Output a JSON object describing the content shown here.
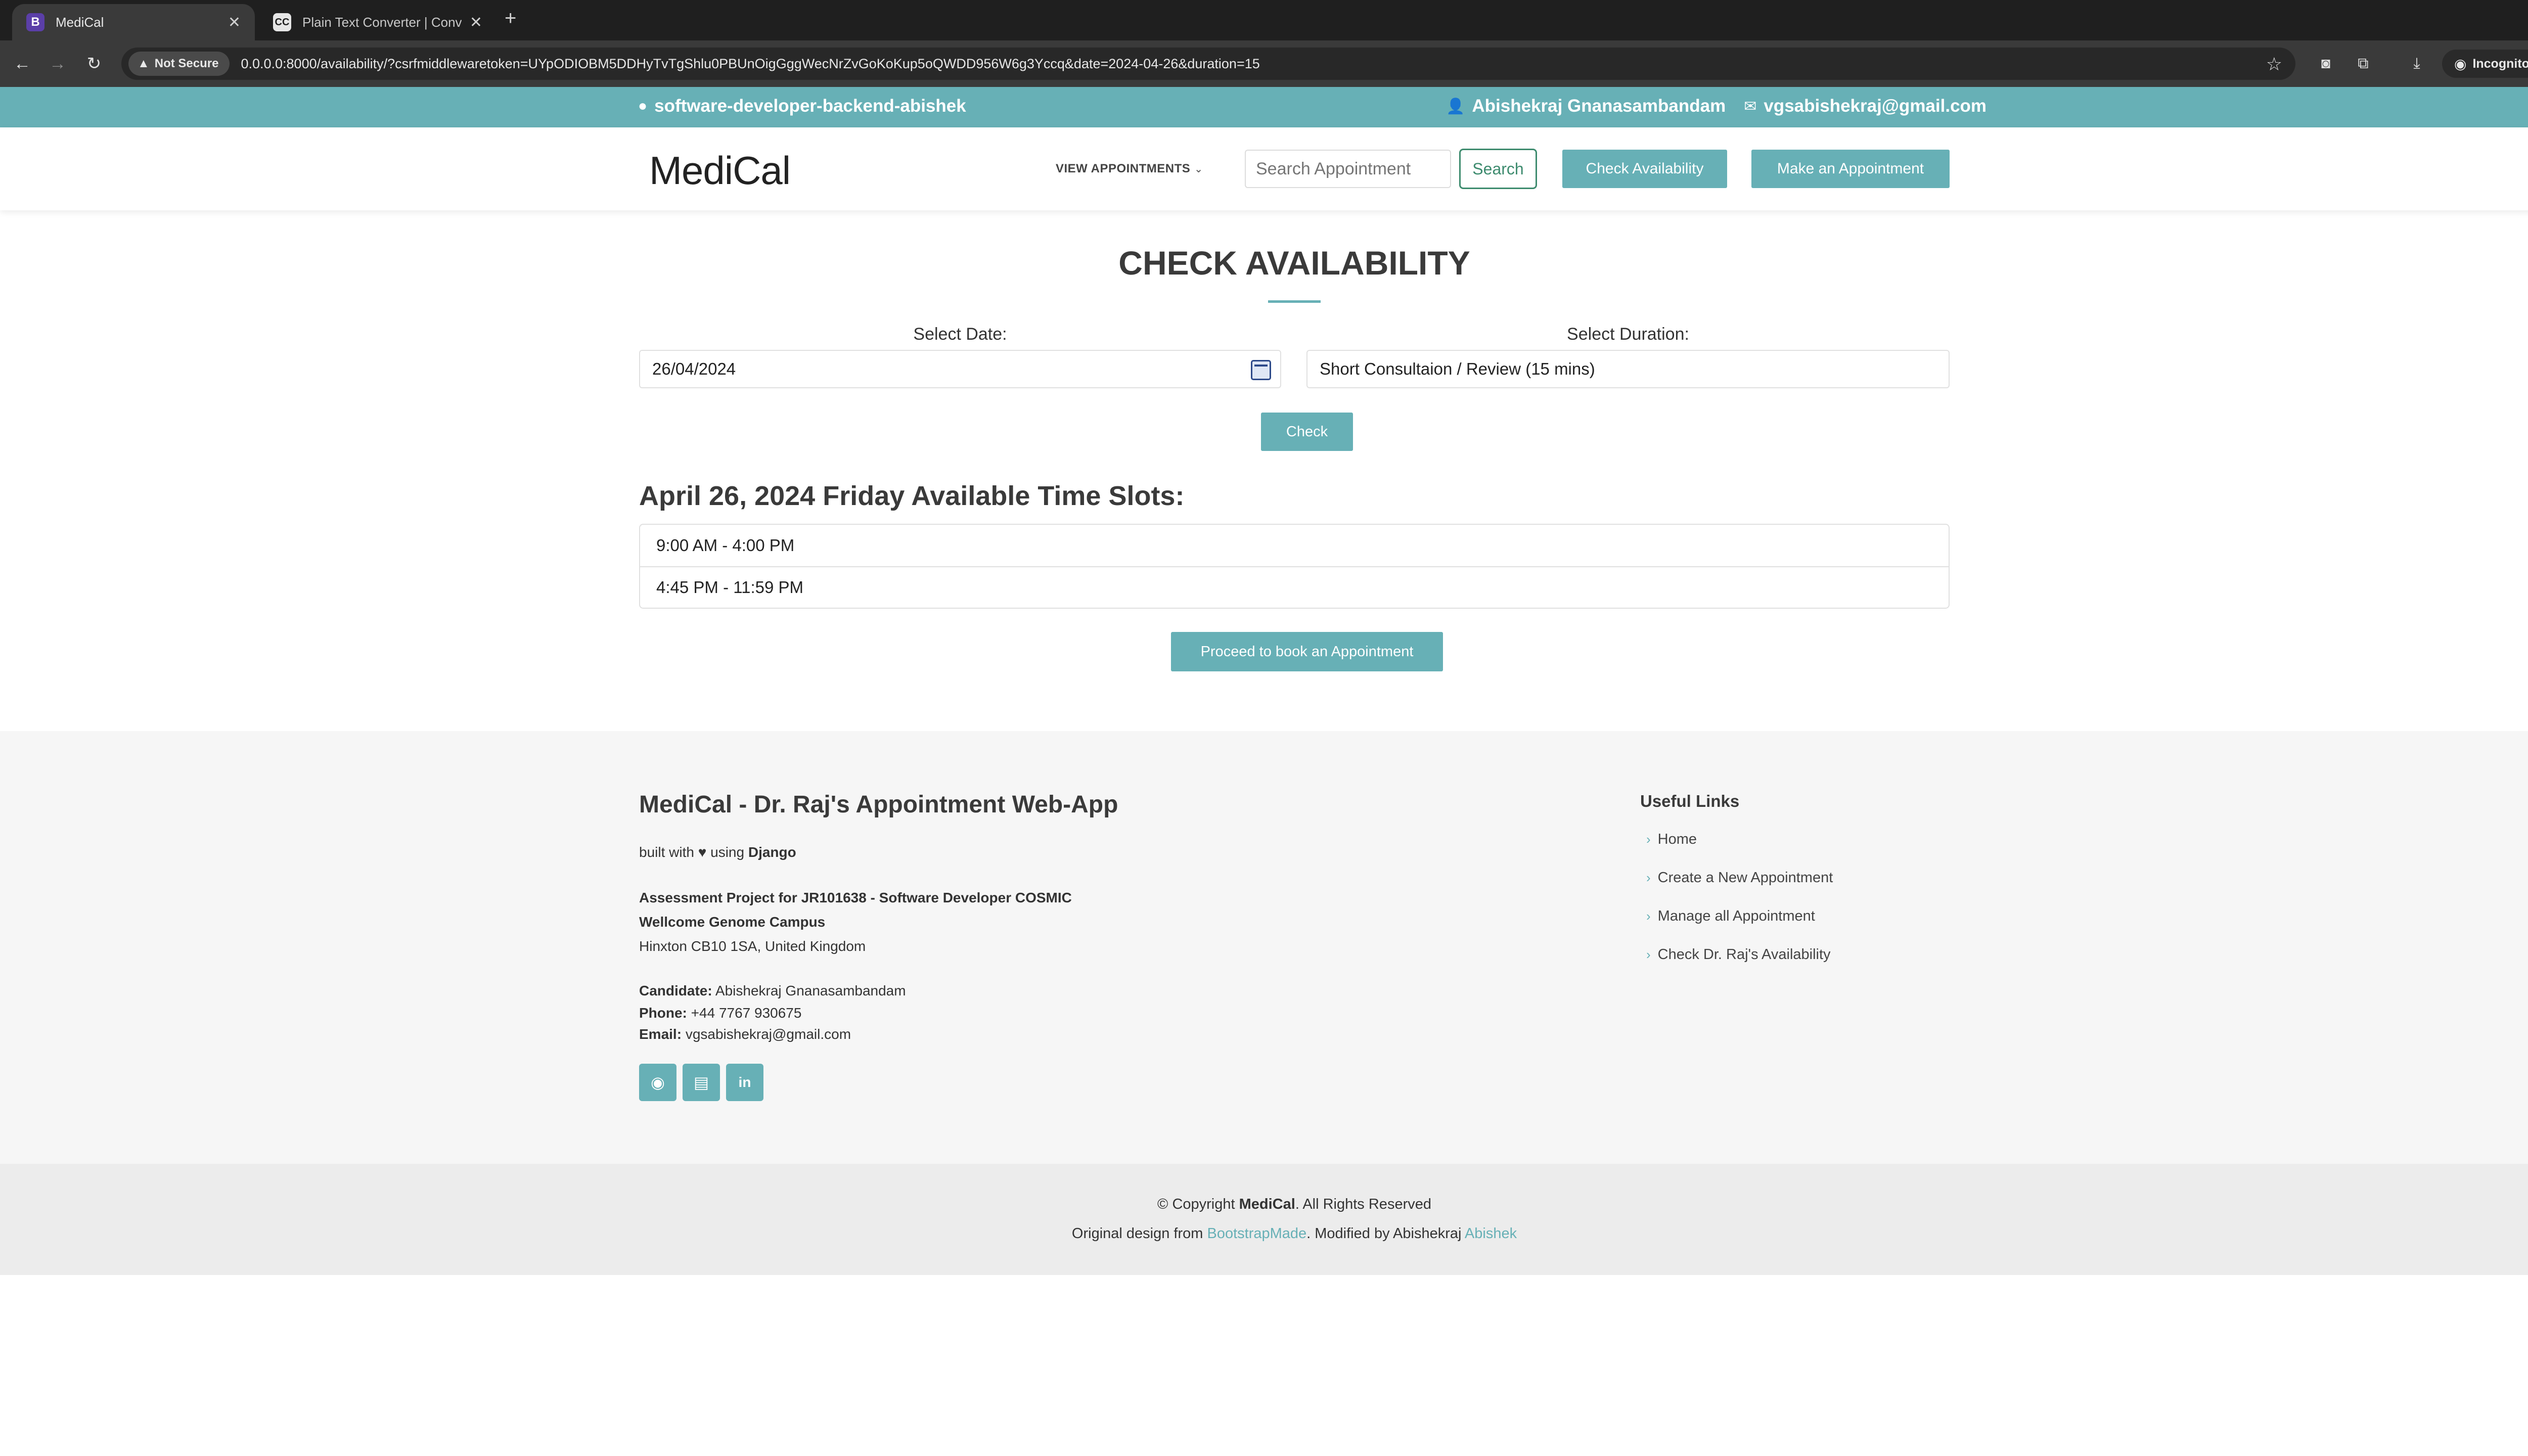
{
  "browser": {
    "tabs": [
      {
        "favicon": "B",
        "title": "MediCal",
        "active": true
      },
      {
        "favicon": "CC",
        "title": "Plain Text Converter | Conve",
        "active": false
      }
    ],
    "not_secure": "Not Secure",
    "url": "0.0.0.0:8000/availability/?csrfmiddlewaretoken=UYpODIOBM5DDHyTvTgShlu0PBUnOigGggWecNrZvGoKoKup5oQWDD956W6g3Yccq&date=2024-04-26&duration=15",
    "incognito_label": "Incognito"
  },
  "topbar": {
    "repo": "software-developer-backend-abishek",
    "user": "Abishekraj Gnanasambandam",
    "email": "vgsabishekraj@gmail.com"
  },
  "header": {
    "logo": "MediCal",
    "view_appointments": "VIEW APPOINTMENTS",
    "search_placeholder": "Search Appointment",
    "search_button": "Search",
    "check_availability": "Check Availability",
    "make_appointment": "Make an Appointment"
  },
  "main": {
    "title": "CHECK AVAILABILITY",
    "date_label": "Select Date:",
    "date_value": "26/04/2024",
    "duration_label": "Select Duration:",
    "duration_value": "Short Consultaion / Review (15 mins)",
    "check_button": "Check",
    "slots_title": "April 26, 2024 Friday Available Time Slots:",
    "slots": [
      "9:00 AM - 4:00 PM",
      "4:45 PM - 11:59 PM"
    ],
    "proceed_button": "Proceed to book an Appointment"
  },
  "footer": {
    "title": "MediCal - Dr. Raj's Appointment Web-App",
    "built_with": "built with",
    "using": "using",
    "framework": "Django",
    "project_line": "Assessment Project for JR101638 - Software Developer COSMIC",
    "campus": "Wellcome Genome Campus",
    "address": "Hinxton CB10 1SA, United Kingdom",
    "candidate_label": "Candidate:",
    "candidate": "Abishekraj Gnanasambandam",
    "phone_label": "Phone:",
    "phone": "+44 7767 930675",
    "email_label": "Email:",
    "email": "vgsabishekraj@gmail.com",
    "social_icons": [
      "github-icon",
      "resume-icon",
      "linkedin-icon"
    ],
    "useful_links_title": "Useful Links",
    "useful_links": [
      "Home",
      "Create a New Appointment",
      "Manage all Appointment",
      "Check Dr. Raj's Availability"
    ]
  },
  "copyright": {
    "prefix": "© Copyright",
    "brand": "MediCal",
    "suffix": ". All Rights Reserved",
    "design_prefix": "Original design from",
    "design_link": "BootstrapMade",
    "modified": ". Modified by Abishekraj",
    "author_link": "Abishek"
  },
  "colors": {
    "accent": "#67b0b6",
    "search_border": "#3d8b6e",
    "chrome_dark": "#1f1f1f"
  }
}
